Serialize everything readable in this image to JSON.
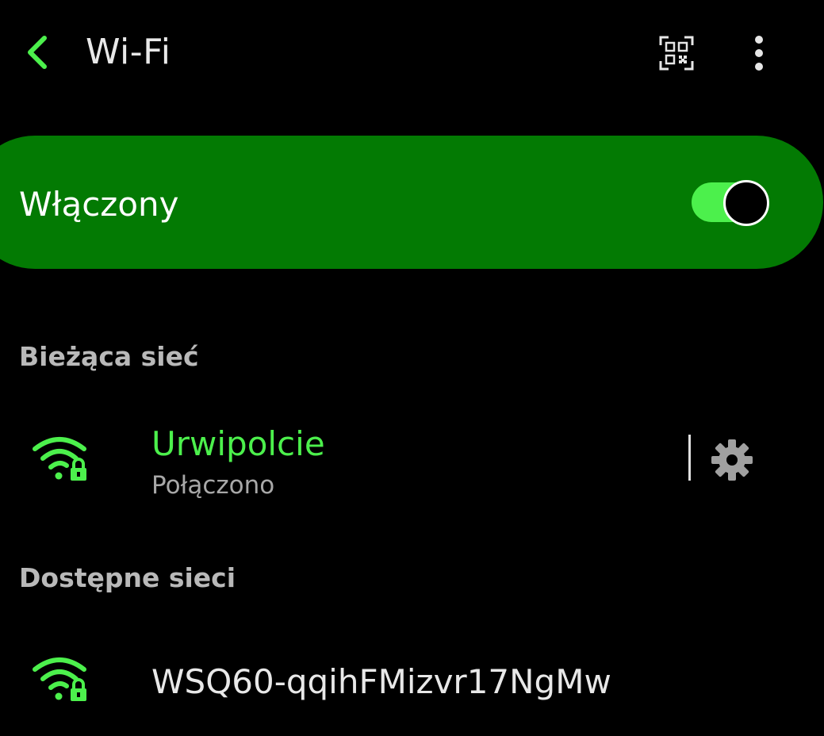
{
  "header": {
    "title": "Wi-Fi",
    "back_icon": "chevron-left-icon",
    "qr_icon": "qr-code-scan-icon",
    "more_icon": "more-vertical-icon"
  },
  "master_toggle": {
    "label": "Włączony",
    "state": "on"
  },
  "current_network": {
    "section_label": "Bieżąca sieć",
    "name": "Urwipolcie",
    "status": "Połączono",
    "icon": "wifi-lock-icon",
    "settings_icon": "gear-icon"
  },
  "available_networks": {
    "section_label": "Dostępne sieci",
    "items": [
      {
        "name": "WSQ60-qqihFMizvr17NgMw",
        "icon": "wifi-lock-icon"
      }
    ]
  },
  "colors": {
    "background": "#000000",
    "accent": "#4cf04c",
    "card": "#037a03",
    "text": "#e8e8e8",
    "secondary_text": "#a8a8a8",
    "connected_name": "#4cf04c"
  }
}
